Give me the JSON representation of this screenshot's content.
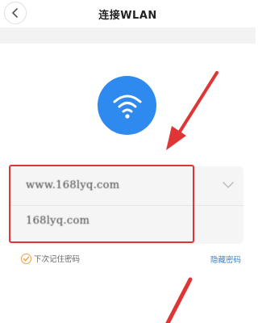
{
  "header": {
    "title": "连接WLAN",
    "back_icon": "chevron-left-icon"
  },
  "network": {
    "ssid": "www.168lyq.com",
    "password": "168lyq.com"
  },
  "options": {
    "remember_label": "下次记住密码",
    "hide_password_label": "隐藏密码"
  },
  "colors": {
    "accent": "#2f8af0",
    "annotation_red": "#e03535",
    "link": "#3a7fd0",
    "check": "#f0a040"
  }
}
